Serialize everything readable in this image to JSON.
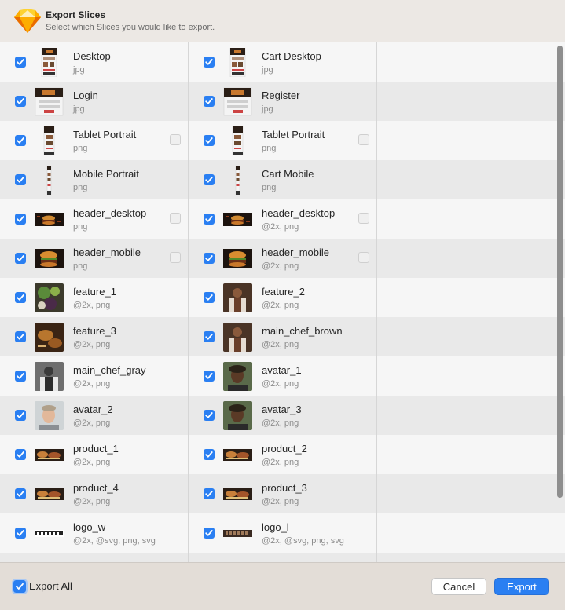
{
  "dialog": {
    "title": "Export Slices",
    "subtitle": "Select which Slices you would like to export."
  },
  "colors": {
    "accent": "#2a7ff2",
    "row_even": "#e9e9e9",
    "row_odd": "#f6f6f6"
  },
  "slices": [
    [
      {
        "name": "Desktop",
        "formats": "jpg",
        "checked": true,
        "trim": false,
        "thumb": "desktop-page"
      },
      {
        "name": "Cart Desktop",
        "formats": "jpg",
        "checked": true,
        "trim": false,
        "thumb": "desktop-page"
      }
    ],
    [
      {
        "name": "Login",
        "formats": "jpg",
        "checked": true,
        "trim": false,
        "thumb": "wide-page"
      },
      {
        "name": "Register",
        "formats": "jpg",
        "checked": true,
        "trim": false,
        "thumb": "wide-page"
      }
    ],
    [
      {
        "name": "Tablet Portrait",
        "formats": "png",
        "checked": true,
        "trim": true,
        "thumb": "tablet-page"
      },
      {
        "name": "Tablet Portrait",
        "formats": "png",
        "checked": true,
        "trim": true,
        "thumb": "tablet-page"
      }
    ],
    [
      {
        "name": "Mobile Portrait",
        "formats": "png",
        "checked": true,
        "trim": false,
        "thumb": "mobile-page"
      },
      {
        "name": "Cart Mobile",
        "formats": "png",
        "checked": true,
        "trim": false,
        "thumb": "mobile-page"
      }
    ],
    [
      {
        "name": "header_desktop",
        "formats": "png",
        "checked": true,
        "trim": true,
        "thumb": "burger-banner"
      },
      {
        "name": "header_desktop",
        "formats": "@2x, png",
        "checked": true,
        "trim": true,
        "thumb": "burger-banner"
      }
    ],
    [
      {
        "name": "header_mobile",
        "formats": "png",
        "checked": true,
        "trim": true,
        "thumb": "burger"
      },
      {
        "name": "header_mobile",
        "formats": "@2x, png",
        "checked": true,
        "trim": true,
        "thumb": "burger"
      }
    ],
    [
      {
        "name": "feature_1",
        "formats": "@2x, png",
        "checked": true,
        "trim": false,
        "thumb": "veggies"
      },
      {
        "name": "feature_2",
        "formats": "@2x, png",
        "checked": true,
        "trim": false,
        "thumb": "chef-brown"
      }
    ],
    [
      {
        "name": "feature_3",
        "formats": "@2x, png",
        "checked": true,
        "trim": false,
        "thumb": "bread"
      },
      {
        "name": "main_chef_brown",
        "formats": "@2x, png",
        "checked": true,
        "trim": false,
        "thumb": "chef-brown"
      }
    ],
    [
      {
        "name": "main_chef_gray",
        "formats": "@2x, png",
        "checked": true,
        "trim": false,
        "thumb": "chef-gray"
      },
      {
        "name": "avatar_1",
        "formats": "@2x, png",
        "checked": true,
        "trim": false,
        "thumb": "avatar-dark"
      }
    ],
    [
      {
        "name": "avatar_2",
        "formats": "@2x, png",
        "checked": true,
        "trim": false,
        "thumb": "avatar-light"
      },
      {
        "name": "avatar_3",
        "formats": "@2x, png",
        "checked": true,
        "trim": false,
        "thumb": "avatar-dark"
      }
    ],
    [
      {
        "name": "product_1",
        "formats": "@2x, png",
        "checked": true,
        "trim": false,
        "thumb": "food-strip"
      },
      {
        "name": "product_2",
        "formats": "@2x, png",
        "checked": true,
        "trim": false,
        "thumb": "food-strip"
      }
    ],
    [
      {
        "name": "product_4",
        "formats": "@2x, png",
        "checked": true,
        "trim": false,
        "thumb": "food-strip"
      },
      {
        "name": "product_3",
        "formats": "@2x, png",
        "checked": true,
        "trim": false,
        "thumb": "food-strip"
      }
    ],
    [
      {
        "name": "logo_w",
        "formats": "@2x, @svg, png, svg",
        "checked": true,
        "trim": false,
        "thumb": "logo-white"
      },
      {
        "name": "logo_l",
        "formats": "@2x, @svg, png, svg",
        "checked": true,
        "trim": false,
        "thumb": "logo-dark"
      }
    ]
  ],
  "footer": {
    "export_all_label": "Export All",
    "export_all_checked": true,
    "cancel_label": "Cancel",
    "export_label": "Export"
  }
}
